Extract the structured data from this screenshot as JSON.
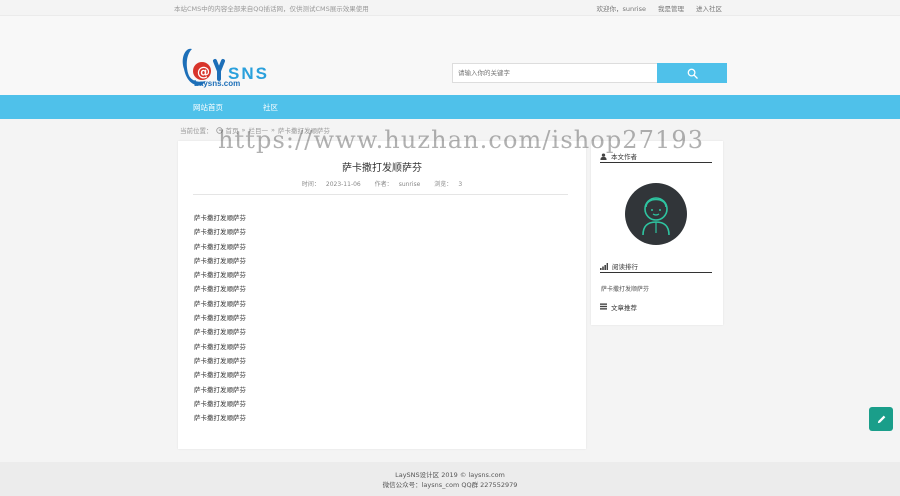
{
  "topbar": {
    "notice": "本站CMS中的内容全部来自QQ插话网，仅供测试CMS展示效果使用",
    "welcome": "欢迎你，sunrise",
    "admin_link": "我是管理",
    "enter_community": "进入社区"
  },
  "header": {
    "logo_text": "LaySNS",
    "logo_sub": "Laysns.com",
    "search_placeholder": "请输入你的关键字"
  },
  "nav": {
    "items": [
      {
        "label": "网站首页"
      },
      {
        "label": "社区"
      }
    ]
  },
  "breadcrumb": {
    "prefix": "当前位置：",
    "home": "首页",
    "sep1": "»",
    "column": "栏目一",
    "sep2": "»",
    "current": "萨卡撒打发顺萨芬"
  },
  "article": {
    "title": "萨卡撒打发顺萨芬",
    "time_label": "时间：",
    "time": "2023-11-06",
    "author_label": "作者：",
    "author": "sunrise",
    "views_label": "浏览：",
    "views": "3",
    "paragraphs": [
      "萨卡撒打发顺萨芬",
      "萨卡撒打发顺萨芬",
      "萨卡撒打发顺萨芬",
      "萨卡撒打发顺萨芬",
      "萨卡撒打发顺萨芬",
      "萨卡撒打发顺萨芬",
      "萨卡撒打发顺萨芬",
      "萨卡撒打发顺萨芬",
      "萨卡撒打发顺萨芬",
      "萨卡撒打发顺萨芬",
      "萨卡撒打发顺萨芬",
      "萨卡撒打发顺萨芬",
      "萨卡撒打发顺萨芬",
      "萨卡撒打发顺萨芬",
      "萨卡撒打发顺萨芬"
    ]
  },
  "sidebar": {
    "author_heading": "本文作者",
    "ranking_heading": "阅读排行",
    "ranking_items": [
      "萨卡撒打发顺萨芬"
    ],
    "recommend_heading": "文章推荐"
  },
  "footer": {
    "line1": "LaySNS设计区 2019 © laysns.com",
    "line2": "微信公众号：laysns_com QQ群 227552979"
  },
  "watermark": "https://www.huzhan.com/ishop27193",
  "colors": {
    "accent": "#4fc1ea",
    "fab": "#1a9e8a",
    "avatar_bg": "#313539",
    "avatar_line": "#2ec4a0"
  }
}
